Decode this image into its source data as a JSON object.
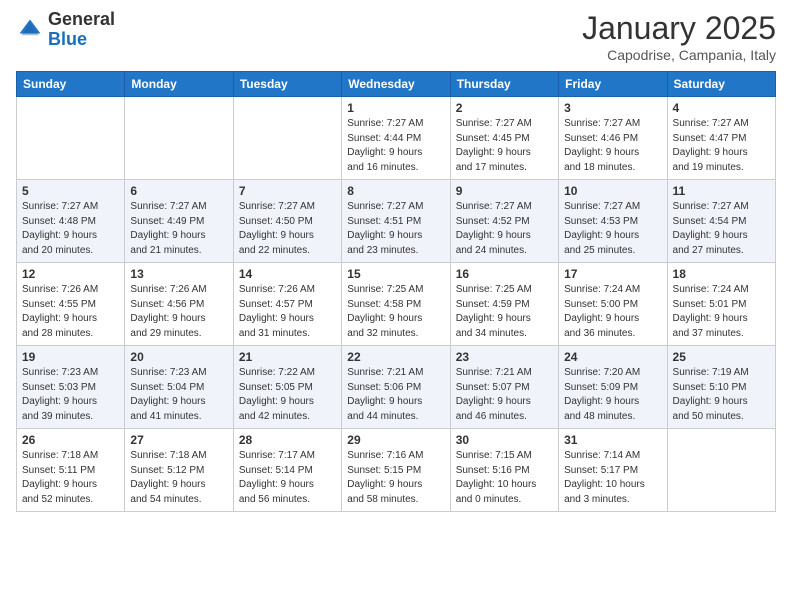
{
  "header": {
    "logo": {
      "line1": "General",
      "line2": "Blue"
    },
    "title": "January 2025",
    "subtitle": "Capodrise, Campania, Italy"
  },
  "days_of_week": [
    "Sunday",
    "Monday",
    "Tuesday",
    "Wednesday",
    "Thursday",
    "Friday",
    "Saturday"
  ],
  "weeks": [
    {
      "row_style": "normal",
      "days": [
        {
          "num": "",
          "info": ""
        },
        {
          "num": "",
          "info": ""
        },
        {
          "num": "",
          "info": ""
        },
        {
          "num": "1",
          "info": "Sunrise: 7:27 AM\nSunset: 4:44 PM\nDaylight: 9 hours\nand 16 minutes."
        },
        {
          "num": "2",
          "info": "Sunrise: 7:27 AM\nSunset: 4:45 PM\nDaylight: 9 hours\nand 17 minutes."
        },
        {
          "num": "3",
          "info": "Sunrise: 7:27 AM\nSunset: 4:46 PM\nDaylight: 9 hours\nand 18 minutes."
        },
        {
          "num": "4",
          "info": "Sunrise: 7:27 AM\nSunset: 4:47 PM\nDaylight: 9 hours\nand 19 minutes."
        }
      ]
    },
    {
      "row_style": "alt",
      "days": [
        {
          "num": "5",
          "info": "Sunrise: 7:27 AM\nSunset: 4:48 PM\nDaylight: 9 hours\nand 20 minutes."
        },
        {
          "num": "6",
          "info": "Sunrise: 7:27 AM\nSunset: 4:49 PM\nDaylight: 9 hours\nand 21 minutes."
        },
        {
          "num": "7",
          "info": "Sunrise: 7:27 AM\nSunset: 4:50 PM\nDaylight: 9 hours\nand 22 minutes."
        },
        {
          "num": "8",
          "info": "Sunrise: 7:27 AM\nSunset: 4:51 PM\nDaylight: 9 hours\nand 23 minutes."
        },
        {
          "num": "9",
          "info": "Sunrise: 7:27 AM\nSunset: 4:52 PM\nDaylight: 9 hours\nand 24 minutes."
        },
        {
          "num": "10",
          "info": "Sunrise: 7:27 AM\nSunset: 4:53 PM\nDaylight: 9 hours\nand 25 minutes."
        },
        {
          "num": "11",
          "info": "Sunrise: 7:27 AM\nSunset: 4:54 PM\nDaylight: 9 hours\nand 27 minutes."
        }
      ]
    },
    {
      "row_style": "normal",
      "days": [
        {
          "num": "12",
          "info": "Sunrise: 7:26 AM\nSunset: 4:55 PM\nDaylight: 9 hours\nand 28 minutes."
        },
        {
          "num": "13",
          "info": "Sunrise: 7:26 AM\nSunset: 4:56 PM\nDaylight: 9 hours\nand 29 minutes."
        },
        {
          "num": "14",
          "info": "Sunrise: 7:26 AM\nSunset: 4:57 PM\nDaylight: 9 hours\nand 31 minutes."
        },
        {
          "num": "15",
          "info": "Sunrise: 7:25 AM\nSunset: 4:58 PM\nDaylight: 9 hours\nand 32 minutes."
        },
        {
          "num": "16",
          "info": "Sunrise: 7:25 AM\nSunset: 4:59 PM\nDaylight: 9 hours\nand 34 minutes."
        },
        {
          "num": "17",
          "info": "Sunrise: 7:24 AM\nSunset: 5:00 PM\nDaylight: 9 hours\nand 36 minutes."
        },
        {
          "num": "18",
          "info": "Sunrise: 7:24 AM\nSunset: 5:01 PM\nDaylight: 9 hours\nand 37 minutes."
        }
      ]
    },
    {
      "row_style": "alt",
      "days": [
        {
          "num": "19",
          "info": "Sunrise: 7:23 AM\nSunset: 5:03 PM\nDaylight: 9 hours\nand 39 minutes."
        },
        {
          "num": "20",
          "info": "Sunrise: 7:23 AM\nSunset: 5:04 PM\nDaylight: 9 hours\nand 41 minutes."
        },
        {
          "num": "21",
          "info": "Sunrise: 7:22 AM\nSunset: 5:05 PM\nDaylight: 9 hours\nand 42 minutes."
        },
        {
          "num": "22",
          "info": "Sunrise: 7:21 AM\nSunset: 5:06 PM\nDaylight: 9 hours\nand 44 minutes."
        },
        {
          "num": "23",
          "info": "Sunrise: 7:21 AM\nSunset: 5:07 PM\nDaylight: 9 hours\nand 46 minutes."
        },
        {
          "num": "24",
          "info": "Sunrise: 7:20 AM\nSunset: 5:09 PM\nDaylight: 9 hours\nand 48 minutes."
        },
        {
          "num": "25",
          "info": "Sunrise: 7:19 AM\nSunset: 5:10 PM\nDaylight: 9 hours\nand 50 minutes."
        }
      ]
    },
    {
      "row_style": "normal",
      "days": [
        {
          "num": "26",
          "info": "Sunrise: 7:18 AM\nSunset: 5:11 PM\nDaylight: 9 hours\nand 52 minutes."
        },
        {
          "num": "27",
          "info": "Sunrise: 7:18 AM\nSunset: 5:12 PM\nDaylight: 9 hours\nand 54 minutes."
        },
        {
          "num": "28",
          "info": "Sunrise: 7:17 AM\nSunset: 5:14 PM\nDaylight: 9 hours\nand 56 minutes."
        },
        {
          "num": "29",
          "info": "Sunrise: 7:16 AM\nSunset: 5:15 PM\nDaylight: 9 hours\nand 58 minutes."
        },
        {
          "num": "30",
          "info": "Sunrise: 7:15 AM\nSunset: 5:16 PM\nDaylight: 10 hours\nand 0 minutes."
        },
        {
          "num": "31",
          "info": "Sunrise: 7:14 AM\nSunset: 5:17 PM\nDaylight: 10 hours\nand 3 minutes."
        },
        {
          "num": "",
          "info": ""
        }
      ]
    }
  ]
}
